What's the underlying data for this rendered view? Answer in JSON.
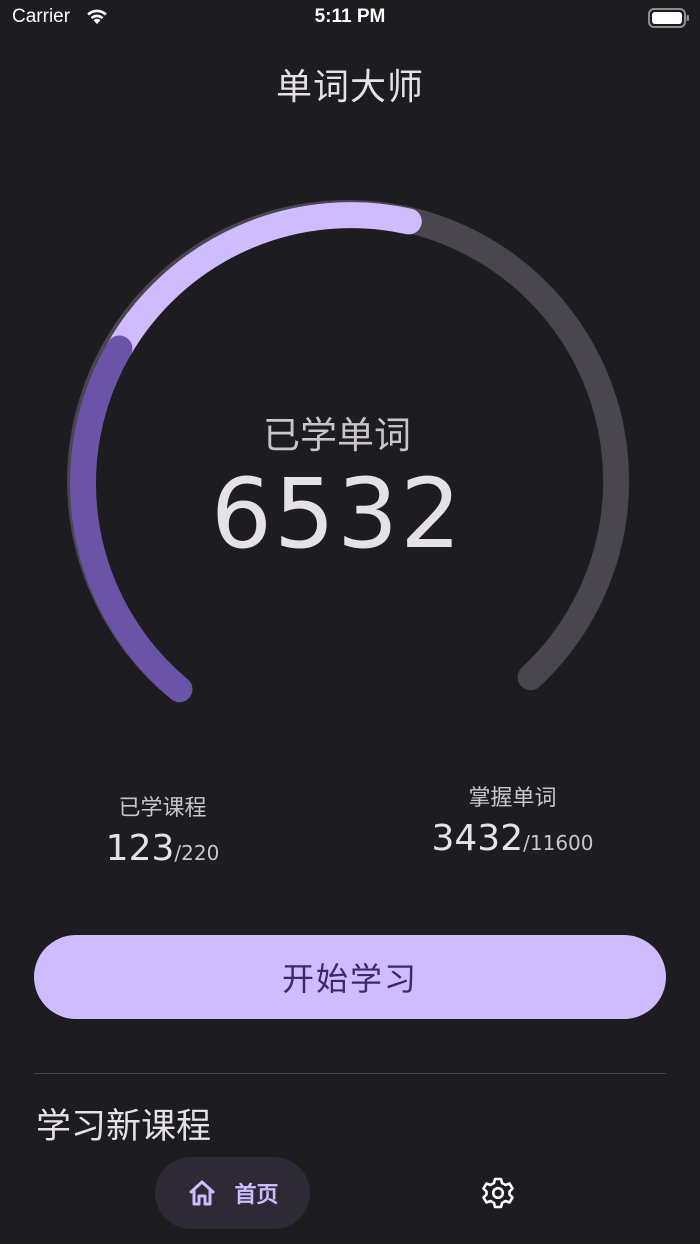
{
  "status_bar": {
    "carrier": "Carrier",
    "time": "5:11 PM"
  },
  "app": {
    "title": "单词大师"
  },
  "gauge": {
    "label": "已学单词",
    "value": "6532",
    "colors": {
      "track": "#4a4650",
      "progress_light": "#cfbcfe",
      "progress_dark": "#6b54a8"
    }
  },
  "stats": {
    "courses": {
      "label": "已学课程",
      "value": "123",
      "separator": "/",
      "total": "220"
    },
    "words": {
      "label": "掌握单词",
      "value": "3432",
      "separator": "/",
      "total": "11600"
    }
  },
  "actions": {
    "start_label": "开始学习"
  },
  "section": {
    "title": "学习新课程"
  },
  "nav": {
    "home_label": "首页",
    "home_icon": "home-icon",
    "settings_icon": "gear-icon"
  },
  "theme": {
    "background": "#1d1c20",
    "accent": "#cfbcfe"
  }
}
